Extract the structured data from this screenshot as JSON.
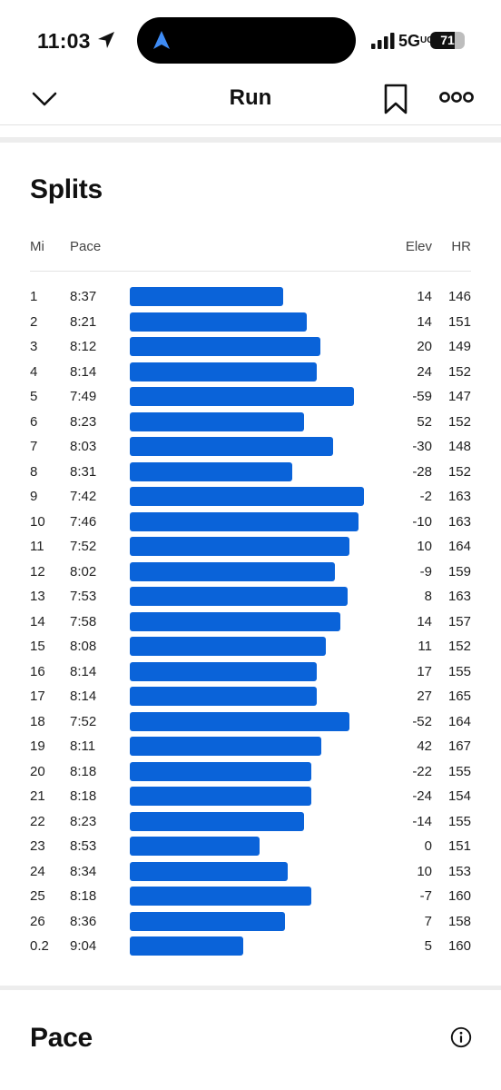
{
  "status_bar": {
    "time": "11:03",
    "network": "5G",
    "network_sup": "UC",
    "battery_level": "71",
    "battery_percent": 71,
    "accent": "#3f8cf5"
  },
  "nav": {
    "title": "Run",
    "back_icon": "chevron-down-icon",
    "bookmark_icon": "bookmark-icon",
    "more_icon": "more-icon"
  },
  "splits": {
    "title": "Splits",
    "headers": {
      "mi": "Mi",
      "pace": "Pace",
      "elev": "Elev",
      "hr": "HR"
    },
    "bar_color": "#0a63d9",
    "rows": [
      {
        "mi": "1",
        "pace": "8:37",
        "elev": "14",
        "hr": "146",
        "pace_seconds": 517
      },
      {
        "mi": "2",
        "pace": "8:21",
        "elev": "14",
        "hr": "151",
        "pace_seconds": 501
      },
      {
        "mi": "3",
        "pace": "8:12",
        "elev": "20",
        "hr": "149",
        "pace_seconds": 492
      },
      {
        "mi": "4",
        "pace": "8:14",
        "elev": "24",
        "hr": "152",
        "pace_seconds": 494
      },
      {
        "mi": "5",
        "pace": "7:49",
        "elev": "-59",
        "hr": "147",
        "pace_seconds": 469
      },
      {
        "mi": "6",
        "pace": "8:23",
        "elev": "52",
        "hr": "152",
        "pace_seconds": 503
      },
      {
        "mi": "7",
        "pace": "8:03",
        "elev": "-30",
        "hr": "148",
        "pace_seconds": 483
      },
      {
        "mi": "8",
        "pace": "8:31",
        "elev": "-28",
        "hr": "152",
        "pace_seconds": 511
      },
      {
        "mi": "9",
        "pace": "7:42",
        "elev": "-2",
        "hr": "163",
        "pace_seconds": 462
      },
      {
        "mi": "10",
        "pace": "7:46",
        "elev": "-10",
        "hr": "163",
        "pace_seconds": 466
      },
      {
        "mi": "11",
        "pace": "7:52",
        "elev": "10",
        "hr": "164",
        "pace_seconds": 472
      },
      {
        "mi": "12",
        "pace": "8:02",
        "elev": "-9",
        "hr": "159",
        "pace_seconds": 482
      },
      {
        "mi": "13",
        "pace": "7:53",
        "elev": "8",
        "hr": "163",
        "pace_seconds": 473
      },
      {
        "mi": "14",
        "pace": "7:58",
        "elev": "14",
        "hr": "157",
        "pace_seconds": 478
      },
      {
        "mi": "15",
        "pace": "8:08",
        "elev": "11",
        "hr": "152",
        "pace_seconds": 488
      },
      {
        "mi": "16",
        "pace": "8:14",
        "elev": "17",
        "hr": "155",
        "pace_seconds": 494
      },
      {
        "mi": "17",
        "pace": "8:14",
        "elev": "27",
        "hr": "165",
        "pace_seconds": 494
      },
      {
        "mi": "18",
        "pace": "7:52",
        "elev": "-52",
        "hr": "164",
        "pace_seconds": 472
      },
      {
        "mi": "19",
        "pace": "8:11",
        "elev": "42",
        "hr": "167",
        "pace_seconds": 491
      },
      {
        "mi": "20",
        "pace": "8:18",
        "elev": "-22",
        "hr": "155",
        "pace_seconds": 498
      },
      {
        "mi": "21",
        "pace": "8:18",
        "elev": "-24",
        "hr": "154",
        "pace_seconds": 498
      },
      {
        "mi": "22",
        "pace": "8:23",
        "elev": "-14",
        "hr": "155",
        "pace_seconds": 503
      },
      {
        "mi": "23",
        "pace": "8:53",
        "elev": "0",
        "hr": "151",
        "pace_seconds": 533
      },
      {
        "mi": "24",
        "pace": "8:34",
        "elev": "10",
        "hr": "153",
        "pace_seconds": 514
      },
      {
        "mi": "25",
        "pace": "8:18",
        "elev": "-7",
        "hr": "160",
        "pace_seconds": 498
      },
      {
        "mi": "26",
        "pace": "8:36",
        "elev": "7",
        "hr": "158",
        "pace_seconds": 516
      },
      {
        "mi": "0.2",
        "pace": "9:04",
        "elev": "5",
        "hr": "160",
        "pace_seconds": 544
      }
    ]
  },
  "pace_section": {
    "title": "Pace",
    "info_icon": "info-icon"
  }
}
